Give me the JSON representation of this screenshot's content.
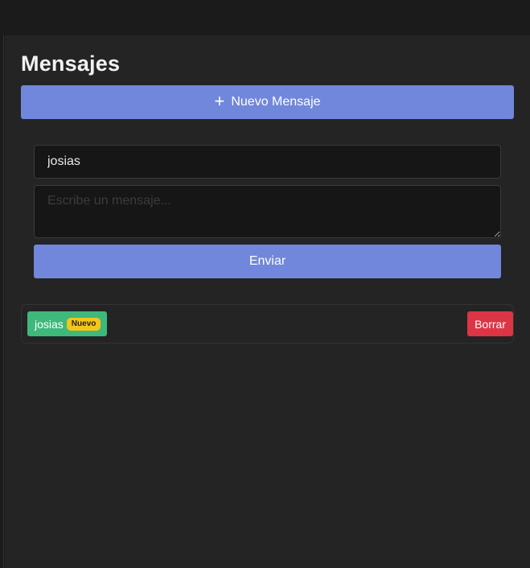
{
  "page": {
    "title": "Mensajes"
  },
  "toolbar": {
    "new_message_icon": "plus-icon",
    "new_message_icon_glyph": "+",
    "new_message_label": "Nuevo Mensaje"
  },
  "form": {
    "name_value": "josias",
    "message_value": "",
    "message_placeholder": "Escribe un mensaje...",
    "send_label": "Enviar"
  },
  "messages": [
    {
      "sender": "josias",
      "badge": "Nuevo",
      "delete_label": "Borrar"
    }
  ],
  "colors": {
    "accent": "#7087db",
    "sender_chip": "#3fb87c",
    "badge": "#f5c518",
    "danger": "#dc3545",
    "background": "#242424"
  }
}
